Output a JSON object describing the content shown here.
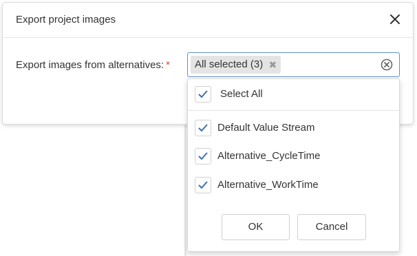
{
  "dialog": {
    "title": "Export project images",
    "close_icon": "close-icon"
  },
  "form": {
    "label": "Export images from alternatives:",
    "required_marker": "*",
    "selection_tag": "All selected (3)",
    "tag_remove_glyph": "✖",
    "clear_icon": "clear-circle-icon",
    "accent_color": "#5b8fc9",
    "required_color": "#d9453c"
  },
  "dropdown": {
    "select_all": {
      "label": "Select All",
      "checked": true
    },
    "options": [
      {
        "label": "Default Value Stream",
        "checked": true
      },
      {
        "label": "Alternative_CycleTime",
        "checked": true
      },
      {
        "label": "Alternative_WorkTime",
        "checked": true
      }
    ],
    "ok_label": "OK",
    "cancel_label": "Cancel",
    "check_color": "#3d6fb0"
  }
}
